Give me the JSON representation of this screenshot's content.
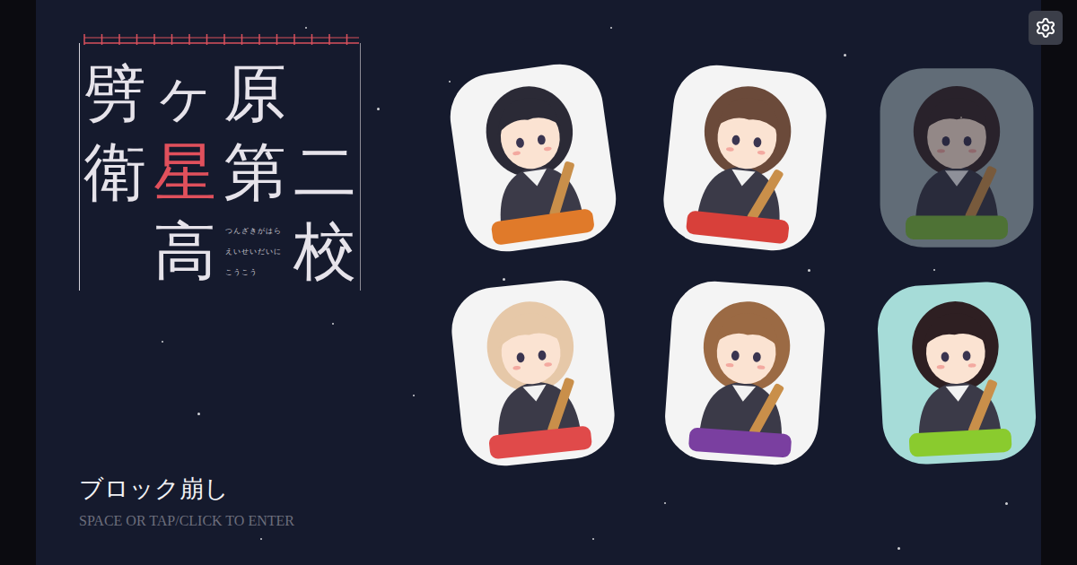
{
  "title": {
    "rows": [
      [
        {
          "kind": "char",
          "text": "劈",
          "color": "#e6e3ea"
        },
        {
          "kind": "char",
          "text": "ヶ",
          "color": "#e6e3ea"
        },
        {
          "kind": "char",
          "text": "原",
          "color": "#e6e3ea"
        },
        {
          "kind": "empty"
        }
      ],
      [
        {
          "kind": "char",
          "text": "衛",
          "color": "#e6e3ea"
        },
        {
          "kind": "char",
          "text": "星",
          "color": "#e0505c"
        },
        {
          "kind": "char",
          "text": "第",
          "color": "#e6e3ea"
        },
        {
          "kind": "char",
          "text": "二",
          "color": "#e6e3ea"
        }
      ],
      [
        {
          "kind": "empty"
        },
        {
          "kind": "char",
          "text": "高",
          "color": "#e6e3ea"
        },
        {
          "kind": "ruby",
          "lines": [
            "つんざきがはら",
            "えいせいだいに",
            "こうこう"
          ]
        },
        {
          "kind": "char",
          "text": "校",
          "color": "#e6e3ea"
        }
      ]
    ]
  },
  "game": {
    "name": "ブロック崩し",
    "hint": "SPACE OR TAP/CLICK TO ENTER"
  },
  "stickers": [
    {
      "color": "#e07a2a",
      "dimmed": false
    },
    {
      "color": "#d8403a",
      "dimmed": false
    },
    {
      "color": "#7dbb3c",
      "dimmed": true
    },
    {
      "color": "#e04a4a",
      "dimmed": false
    },
    {
      "color": "#7a3fa0",
      "dimmed": false
    },
    {
      "color": "#8acb2e",
      "dimmed": false
    }
  ]
}
